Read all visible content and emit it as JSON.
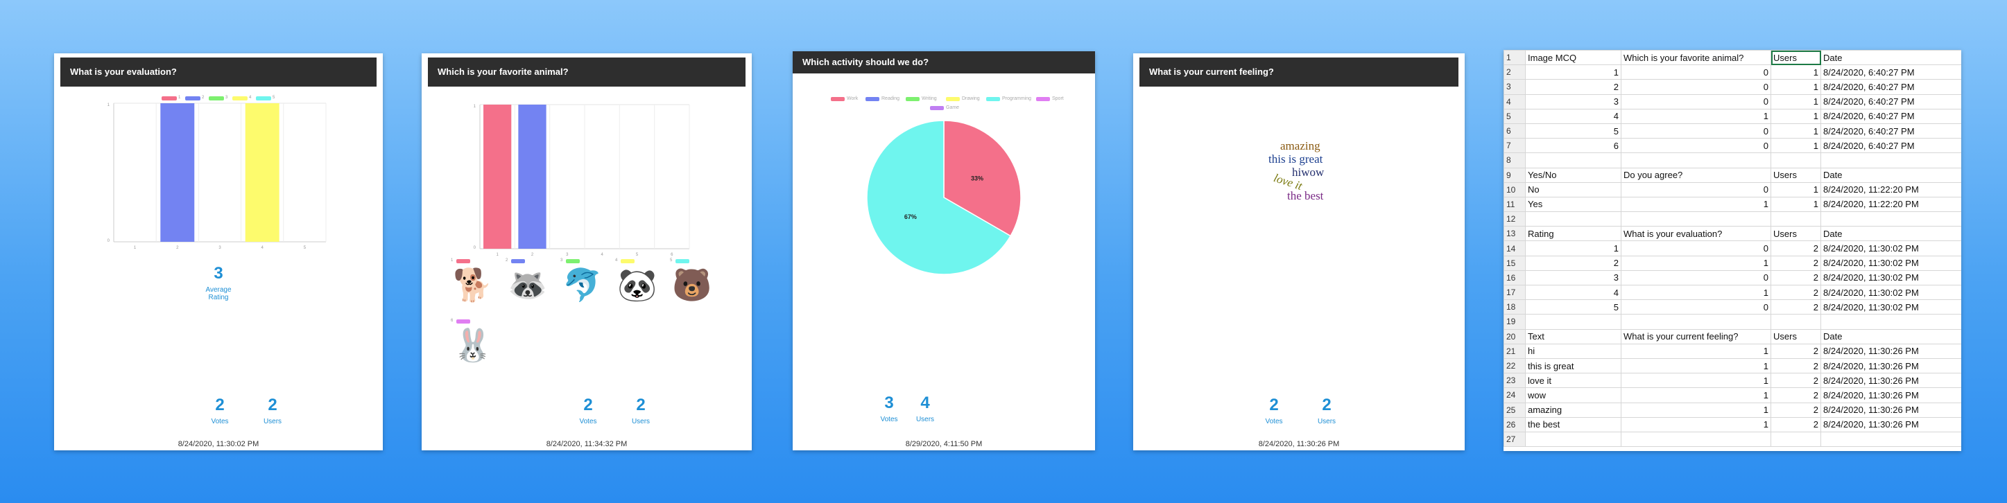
{
  "panels": {
    "rating": {
      "title": "What is your evaluation?",
      "legend_labels": [
        "1",
        "2",
        "3",
        "4",
        "5"
      ],
      "legend_colors": [
        "#f4708a",
        "#7383f2",
        "#7df06f",
        "#fdfb6d",
        "#6ff5ee"
      ],
      "average_value": "3",
      "average_label": "Average Rating",
      "votes_value": "2",
      "votes_label": "Votes",
      "users_value": "2",
      "users_label": "Users",
      "date": "8/24/2020, 11:30:02 PM"
    },
    "animal": {
      "title": "Which is your favorite animal?",
      "legend_labels": [
        "1",
        "2",
        "3",
        "4",
        "5",
        "6"
      ],
      "legend_colors": [
        "#f4708a",
        "#7383f2",
        "#7df06f",
        "#fdfb6d",
        "#6ff5ee",
        "#e07ef2"
      ],
      "animal_icons": [
        "dog-icon",
        "raccoon-icon",
        "dolphin-icon",
        "panda-icon",
        "bear-icon",
        "rabbit-icon"
      ],
      "votes_value": "2",
      "votes_label": "Votes",
      "users_value": "2",
      "users_label": "Users",
      "date": "8/24/2020, 11:34:32 PM"
    },
    "activity": {
      "title": "Which activity should we do?",
      "votes_value": "3",
      "votes_label": "Votes",
      "users_value": "4",
      "users_label": "Users",
      "date": "8/29/2020, 4:11:50 PM"
    },
    "feeling": {
      "title": "What is your current feeling?",
      "words": [
        "amazing",
        "this is great",
        "hiwow",
        "love it",
        "the best"
      ],
      "word_colors": [
        "#8a5a12",
        "#1c3f8f",
        "#232f6e",
        "#7a7a10",
        "#7a2a86"
      ],
      "votes_value": "2",
      "votes_label": "Votes",
      "users_value": "2",
      "users_label": "Users",
      "date": "8/24/2020, 11:30:26 PM"
    }
  },
  "chart_data": [
    {
      "type": "bar",
      "categories": [
        "1",
        "2",
        "3",
        "4",
        "5"
      ],
      "values": [
        0,
        1,
        0,
        1,
        0
      ],
      "ylim": [
        0,
        1
      ],
      "colors": [
        "#f4708a",
        "#7383f2",
        "#7df06f",
        "#fdfb6d",
        "#6ff5ee"
      ],
      "grid": true,
      "legend": "top"
    },
    {
      "type": "bar",
      "categories": [
        "1",
        "2",
        "3",
        "4",
        "5",
        "6"
      ],
      "values": [
        1,
        1,
        0,
        0,
        0,
        0
      ],
      "ylim": [
        0,
        1
      ],
      "colors": [
        "#f4708a",
        "#7383f2",
        "#7df06f",
        "#fdfb6d",
        "#6ff5ee",
        "#e07ef2"
      ],
      "grid": true
    },
    {
      "type": "pie",
      "categories": [
        "Work",
        "Reading",
        "Writing",
        "Drawing",
        "Programming",
        "Sport",
        "Game"
      ],
      "values": [
        1,
        0,
        0,
        0,
        2,
        0,
        0
      ],
      "slice_labels": [
        "33%",
        "67%"
      ],
      "colors": [
        "#f4708a",
        "#7383f2",
        "#7df06f",
        "#fdfb6d",
        "#6ff5ee",
        "#e07ef2",
        "#c07ef2"
      ],
      "legend": "top"
    }
  ],
  "sheet": {
    "rows": [
      {
        "n": "1",
        "a": "Image MCQ",
        "b": "",
        "c": "Which is your favorite animal?",
        "d": "Users",
        "e": "Date"
      },
      {
        "n": "2",
        "a": "",
        "b": "1",
        "c": "0",
        "d": "1",
        "e": "8/24/2020, 6:40:27 PM"
      },
      {
        "n": "3",
        "a": "",
        "b": "2",
        "c": "0",
        "d": "1",
        "e": "8/24/2020, 6:40:27 PM"
      },
      {
        "n": "4",
        "a": "",
        "b": "3",
        "c": "0",
        "d": "1",
        "e": "8/24/2020, 6:40:27 PM"
      },
      {
        "n": "5",
        "a": "",
        "b": "4",
        "c": "1",
        "d": "1",
        "e": "8/24/2020, 6:40:27 PM"
      },
      {
        "n": "6",
        "a": "",
        "b": "5",
        "c": "0",
        "d": "1",
        "e": "8/24/2020, 6:40:27 PM"
      },
      {
        "n": "7",
        "a": "",
        "b": "6",
        "c": "0",
        "d": "1",
        "e": "8/24/2020, 6:40:27 PM"
      },
      {
        "n": "8",
        "a": "",
        "b": "",
        "c": "",
        "d": "",
        "e": ""
      },
      {
        "n": "9",
        "a": "Yes/No",
        "b": "",
        "c": "Do you agree?",
        "d": "Users",
        "e": "Date"
      },
      {
        "n": "10",
        "a": "No",
        "b": "",
        "c": "0",
        "d": "1",
        "e": "8/24/2020, 11:22:20 PM"
      },
      {
        "n": "11",
        "a": "Yes",
        "b": "",
        "c": "1",
        "d": "1",
        "e": "8/24/2020, 11:22:20 PM"
      },
      {
        "n": "12",
        "a": "",
        "b": "",
        "c": "",
        "d": "",
        "e": ""
      },
      {
        "n": "13",
        "a": "Rating",
        "b": "",
        "c": "What is your evaluation?",
        "d": "Users",
        "e": "Date"
      },
      {
        "n": "14",
        "a": "",
        "b": "1",
        "c": "0",
        "d": "2",
        "e": "8/24/2020, 11:30:02 PM"
      },
      {
        "n": "15",
        "a": "",
        "b": "2",
        "c": "1",
        "d": "2",
        "e": "8/24/2020, 11:30:02 PM"
      },
      {
        "n": "16",
        "a": "",
        "b": "3",
        "c": "0",
        "d": "2",
        "e": "8/24/2020, 11:30:02 PM"
      },
      {
        "n": "17",
        "a": "",
        "b": "4",
        "c": "1",
        "d": "2",
        "e": "8/24/2020, 11:30:02 PM"
      },
      {
        "n": "18",
        "a": "",
        "b": "5",
        "c": "0",
        "d": "2",
        "e": "8/24/2020, 11:30:02 PM"
      },
      {
        "n": "19",
        "a": "",
        "b": "",
        "c": "",
        "d": "",
        "e": ""
      },
      {
        "n": "20",
        "a": "Text",
        "b": "",
        "c": "What is your current feeling?",
        "d": "Users",
        "e": "Date"
      },
      {
        "n": "21",
        "a": "hi",
        "b": "",
        "c": "1",
        "d": "2",
        "e": "8/24/2020, 11:30:26 PM"
      },
      {
        "n": "22",
        "a": "this is great",
        "b": "",
        "c": "1",
        "d": "2",
        "e": "8/24/2020, 11:30:26 PM"
      },
      {
        "n": "23",
        "a": "love it",
        "b": "",
        "c": "1",
        "d": "2",
        "e": "8/24/2020, 11:30:26 PM"
      },
      {
        "n": "24",
        "a": "wow",
        "b": "",
        "c": "1",
        "d": "2",
        "e": "8/24/2020, 11:30:26 PM"
      },
      {
        "n": "25",
        "a": "amazing",
        "b": "",
        "c": "1",
        "d": "2",
        "e": "8/24/2020, 11:30:26 PM"
      },
      {
        "n": "26",
        "a": "the best",
        "b": "",
        "c": "1",
        "d": "2",
        "e": "8/24/2020, 11:30:26 PM"
      },
      {
        "n": "27",
        "a": "",
        "b": "",
        "c": "",
        "d": "",
        "e": ""
      }
    ],
    "selected_cell": "D1"
  }
}
